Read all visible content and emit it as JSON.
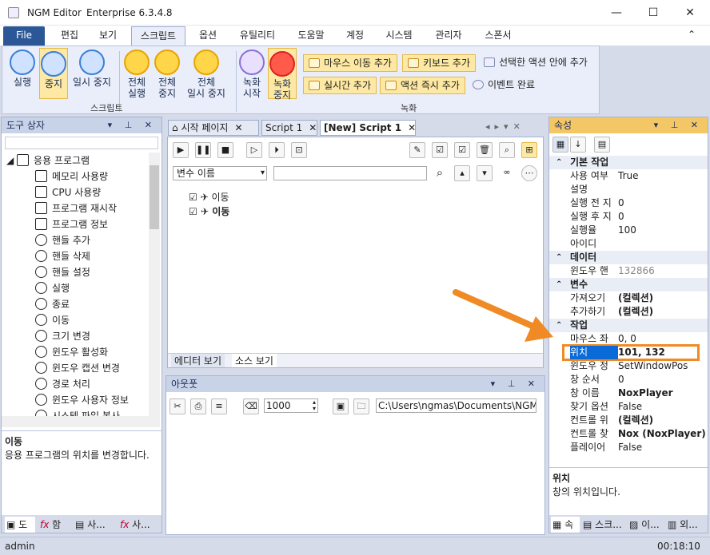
{
  "titlebar": {
    "app_name": "NGM Editor",
    "edition": "Enterprise 6.3.4.8",
    "minimize": "—",
    "maximize": "☐",
    "close": "✕"
  },
  "ribbon_tabs": [
    "File",
    "편집",
    "보기",
    "스크립트",
    "옵션",
    "유틸리티",
    "도움말",
    "계정",
    "시스템",
    "관리자",
    "스폰서"
  ],
  "ribbon": {
    "script_group": {
      "label": "스크립트",
      "run": "실행",
      "stop": "중지",
      "pause": "일시 중지",
      "all_run_1": "전체",
      "all_run_2": "실행",
      "all_stop_1": "전체",
      "all_stop_2": "중지",
      "all_pause_1": "전체",
      "all_pause_2": "일시 중지"
    },
    "record_group": {
      "label": "녹화",
      "rec_start_1": "녹화",
      "rec_start_2": "시작",
      "rec_stop_1": "녹화",
      "rec_stop_2": "중지",
      "add_mouse_move": "마우스 이동 추가",
      "add_keyboard": "키보드 추가",
      "inside_selected": "선택한 액션 안에 추가",
      "add_realtime": "실시간 추가",
      "add_action_now": "액션 즉시 추가",
      "event_done": "이벤트 완료"
    }
  },
  "toolbox": {
    "title": "도구 상자",
    "root": "응용 프로그램",
    "items": [
      "메모리 사용량",
      "CPU 사용량",
      "프로그램 재시작",
      "프로그램 정보",
      "핸들 추가",
      "핸들 삭제",
      "핸들 설정",
      "실행",
      "종료",
      "이동",
      "크기 변경",
      "윈도우 활성화",
      "윈도우 캡션 변경",
      "경로 처리",
      "윈도우 사용자 정보",
      "시스템 파일 복사"
    ],
    "desc_title": "이동",
    "desc_text": "응용 프로그램의 위치를 변경합니다.",
    "bottom_tabs": [
      "도",
      "함",
      "사...",
      "사..."
    ]
  },
  "editor": {
    "tabs": [
      "시작 페이지",
      "Script 1",
      "[New] Script 1"
    ],
    "variable_select": "변수 이름",
    "actions": [
      "이동",
      "이동"
    ],
    "view_tabs": [
      "에디터 보기",
      "소스 보기"
    ]
  },
  "output": {
    "title": "아웃풋",
    "count": "1000",
    "path": "C:\\Users\\ngmas\\Documents\\NGM6\\"
  },
  "properties": {
    "title": "속성",
    "rows": [
      {
        "cat": true,
        "k": "기본 작업"
      },
      {
        "k": "사용 여부",
        "v": "True"
      },
      {
        "k": "설명",
        "v": ""
      },
      {
        "k": "실행 전 지",
        "v": "0"
      },
      {
        "k": "실행 후 지",
        "v": "0"
      },
      {
        "k": "실행율",
        "v": "100"
      },
      {
        "k": "아이디",
        "v": ""
      },
      {
        "cat": true,
        "k": "데이터"
      },
      {
        "k": "윈도우 핸",
        "v": "132866",
        "gray": true
      },
      {
        "cat": true,
        "k": "변수"
      },
      {
        "k": "가져오기",
        "v": "(컬렉션)",
        "bold": true
      },
      {
        "k": "추가하기",
        "v": "(컬렉션)",
        "bold": true
      },
      {
        "cat": true,
        "k": "작업"
      },
      {
        "k": "마우스 좌",
        "v": "0, 0"
      },
      {
        "k": "위치",
        "v": "101, 132",
        "selected": true
      },
      {
        "k": "윈도우 정",
        "v": "SetWindowPos"
      },
      {
        "k": "창 순서",
        "v": "0"
      },
      {
        "k": "창 이름",
        "v": "NoxPlayer",
        "bold": true
      },
      {
        "k": "찾기 옵션",
        "v": "False"
      },
      {
        "k": "컨트롤 위",
        "v": "(컬렉션)",
        "bold": true
      },
      {
        "k": "컨트롤 찾",
        "v": "Nox (NoxPlayer)",
        "bold": true
      },
      {
        "k": "플레이어",
        "v": "False"
      }
    ],
    "desc_title": "위치",
    "desc_text": "창의 위치입니다.",
    "bottom_tabs": [
      "속",
      "스크...",
      "이...",
      "외..."
    ]
  },
  "statusbar": {
    "user": "admin",
    "time": "00:18:10"
  },
  "colors": {
    "accent": "#2b5797",
    "highlight_box": "#f08a24",
    "selection": "#0a6ad8"
  }
}
